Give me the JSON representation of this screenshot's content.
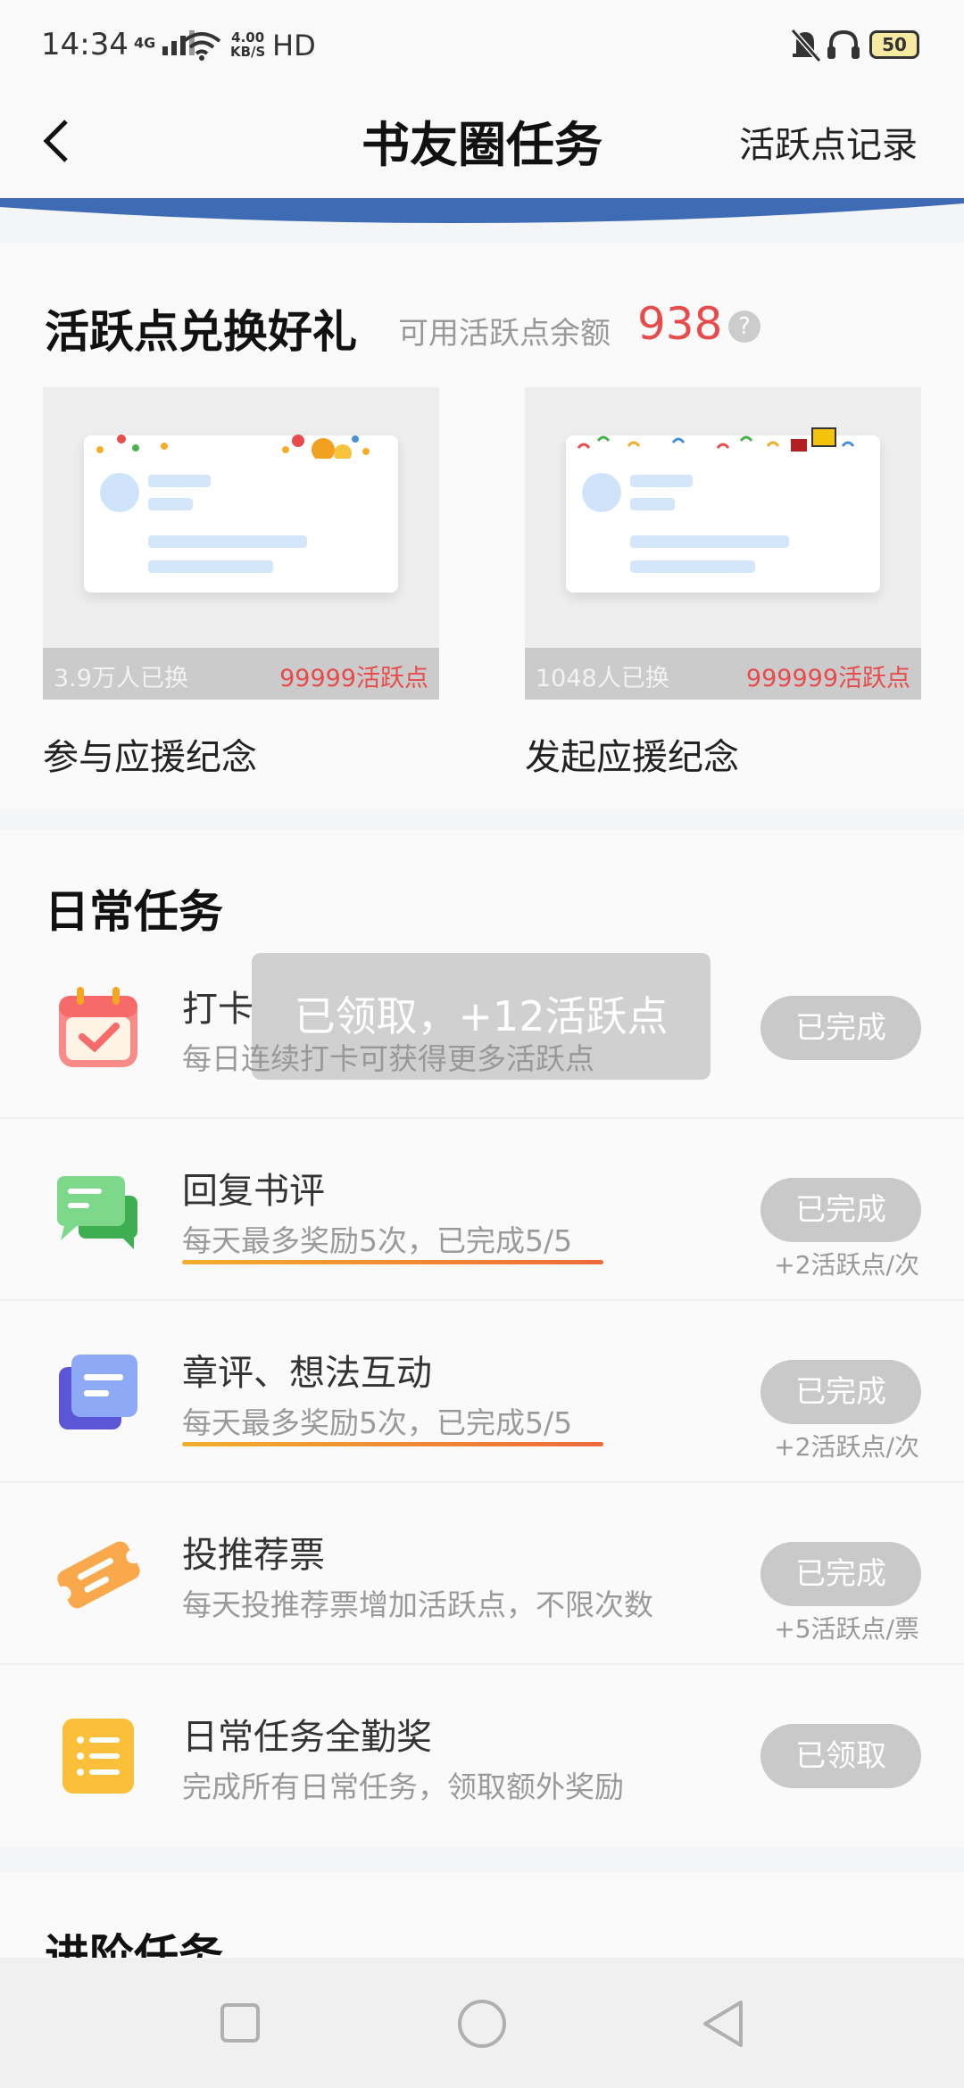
{
  "status_bar": {
    "time": "14:34",
    "network": "4G",
    "speed_value": "4.00",
    "speed_unit": "KB/S",
    "hd": "HD",
    "battery": "50"
  },
  "header": {
    "title": "书友圈任务",
    "right_link": "活跃点记录"
  },
  "exchange": {
    "title": "活跃点兑换好礼",
    "balance_label": "可用活跃点余额",
    "balance_value": "938",
    "items": [
      {
        "count": "3.9万人已换",
        "points": "99999活跃点",
        "name": "参与应援纪念"
      },
      {
        "count": "1048人已换",
        "points": "999999活跃点",
        "name": "发起应援纪念"
      }
    ]
  },
  "daily": {
    "title": "日常任务",
    "tasks": [
      {
        "name": "打卡",
        "desc": "每日连续打卡可获得更多活跃点",
        "button": "已完成",
        "reward": ""
      },
      {
        "name": "回复书评",
        "desc": "每天最多奖励5次，已完成5/5",
        "button": "已完成",
        "reward": "+2活跃点/次"
      },
      {
        "name": "章评、想法互动",
        "desc": "每天最多奖励5次，已完成5/5",
        "button": "已完成",
        "reward": "+2活跃点/次"
      },
      {
        "name": "投推荐票",
        "desc": "每天投推荐票增加活跃点，不限次数",
        "button": "已完成",
        "reward": "+5活跃点/票"
      },
      {
        "name": "日常任务全勤奖",
        "desc": "完成所有日常任务，领取额外奖励",
        "button": "已领取",
        "reward": ""
      }
    ]
  },
  "advanced": {
    "title": "进阶任务"
  },
  "toast": "已领取，+12活跃点",
  "colors": {
    "accent_red": "#e84b4b",
    "progress_start": "#f2ae2c",
    "progress_end": "#ef6a3a",
    "button_gray": "#c9c9c9"
  },
  "icons": [
    "calendar-check-icon",
    "chat-bubbles-icon",
    "note-stack-icon",
    "ticket-icon",
    "list-icon",
    "back-arrow-icon",
    "help-icon",
    "square-nav-icon",
    "circle-nav-icon",
    "triangle-nav-icon"
  ]
}
